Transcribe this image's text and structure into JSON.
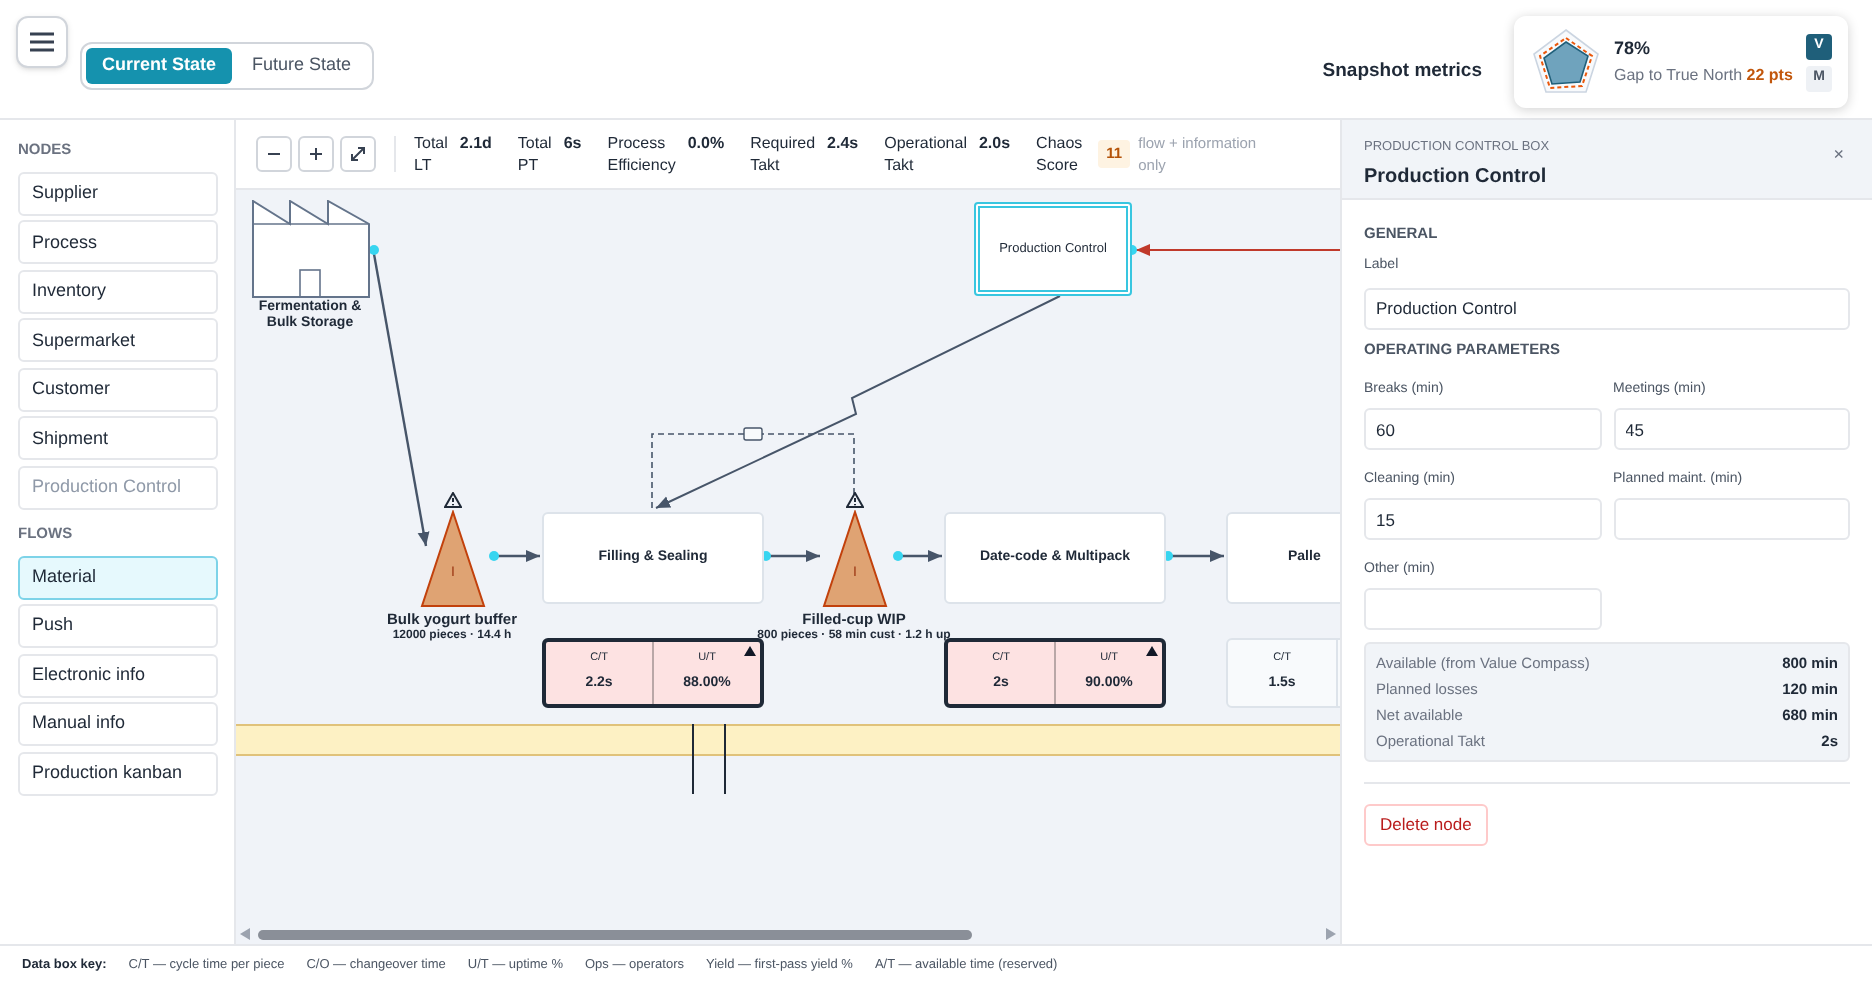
{
  "state_tabs": [
    {
      "label": "Current State",
      "selected": true
    },
    {
      "label": "Future State",
      "selected": false
    }
  ],
  "snapshot": {
    "title": "Snapshot metrics",
    "score": "78%",
    "gap_label": "Gap to True North",
    "gap_value": "22 pts",
    "modes": [
      {
        "label": "V",
        "selected": true
      },
      {
        "label": "M",
        "selected": false
      }
    ]
  },
  "sidebar": [
    {
      "title": "NODES",
      "items": [
        {
          "label": "Supplier",
          "selected": false,
          "disabled": false
        },
        {
          "label": "Process",
          "selected": false,
          "disabled": false
        },
        {
          "label": "Inventory",
          "selected": false,
          "disabled": false
        },
        {
          "label": "Supermarket",
          "selected": false,
          "disabled": false
        },
        {
          "label": "Customer",
          "selected": false,
          "disabled": false
        },
        {
          "label": "Shipment",
          "selected": false,
          "disabled": false
        },
        {
          "label": "Production Control",
          "selected": false,
          "disabled": true
        }
      ]
    },
    {
      "title": "FLOWS",
      "items": [
        {
          "label": "Material",
          "selected": true,
          "disabled": false
        },
        {
          "label": "Push",
          "selected": false,
          "disabled": false
        },
        {
          "label": "Electronic info",
          "selected": false,
          "disabled": false
        },
        {
          "label": "Manual info",
          "selected": false,
          "disabled": false
        },
        {
          "label": "Production kanban",
          "selected": false,
          "disabled": false
        }
      ]
    }
  ],
  "toolbar": {
    "metrics": [
      {
        "label": "Total LT",
        "value": "2.1d"
      },
      {
        "label": "Total PT",
        "value": "6s"
      },
      {
        "label": "Process Efficiency",
        "value": "0.0%"
      },
      {
        "label": "Required Takt",
        "value": "2.4s"
      },
      {
        "label": "Operational Takt",
        "value": "2.0s"
      }
    ],
    "chaos": {
      "label": "Chaos Score",
      "value": "11",
      "note": "flow + information only"
    }
  },
  "canvas": {
    "supplier": {
      "label": "Fermentation & Bulk Storage"
    },
    "production_control": {
      "label": "Production Control",
      "selected": true
    },
    "inventories": [
      {
        "glyph": "I",
        "name": "Bulk yogurt buffer",
        "detail": "12000 pieces · 14.4 h",
        "warning": true
      },
      {
        "glyph": "I",
        "name": "Filled-cup WIP",
        "detail": "800 pieces · 58 min cust · 1.2 h up",
        "warning": true
      }
    ],
    "processes": [
      {
        "name": "Filling & Sealing",
        "flagged": true,
        "data_box": [
          {
            "label": "C/T",
            "value": "2.2s"
          },
          {
            "label": "U/T",
            "value": "88.00%"
          }
        ]
      },
      {
        "name": "Date-code & Multipack",
        "flagged": true,
        "data_box": [
          {
            "label": "C/T",
            "value": "2s"
          },
          {
            "label": "U/T",
            "value": "90.00%"
          }
        ]
      },
      {
        "name": "Palle",
        "flagged": false,
        "data_box": [
          {
            "label": "C/T",
            "value": "1.5s"
          }
        ]
      }
    ]
  },
  "inspector": {
    "kind_label": "PRODUCTION CONTROL BOX",
    "title": "Production Control",
    "close": "×",
    "general_title": "GENERAL",
    "label_field": {
      "label": "Label",
      "value": "Production Control"
    },
    "params_title": "OPERATING PARAMETERS",
    "params": [
      {
        "label": "Breaks (min)",
        "value": "60"
      },
      {
        "label": "Meetings (min)",
        "value": "45"
      },
      {
        "label": "Cleaning (min)",
        "value": "15"
      },
      {
        "label": "Planned maint. (min)"
      },
      {
        "label": "Other (min)"
      }
    ],
    "summary": [
      {
        "label": "Available (from Value Compass)",
        "value": "800 min"
      },
      {
        "label": "Planned losses",
        "value": "120 min"
      },
      {
        "label": "Net available",
        "value": "680 min"
      },
      {
        "label": "Operational Takt",
        "value": "2s"
      }
    ],
    "delete_button": "Delete node"
  },
  "legend": {
    "title": "Data box key:",
    "items": [
      "C/T — cycle time per piece",
      "C/O — changeover time",
      "U/T — uptime %",
      "Ops — operators",
      "Yield — first-pass yield %",
      "A/T — available time (reserved)"
    ]
  }
}
